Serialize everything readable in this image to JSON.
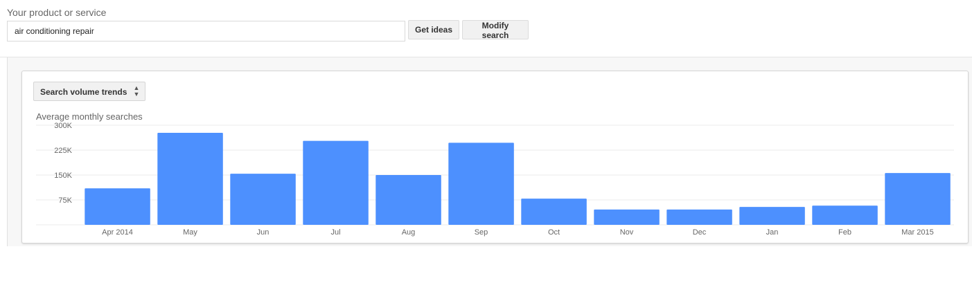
{
  "search": {
    "label": "Your product or service",
    "value": "air conditioning repair",
    "placeholder": ""
  },
  "buttons": {
    "get_ideas": "Get ideas",
    "modify_search": "Modify search"
  },
  "chart_panel": {
    "dropdown_label": "Search volume trends",
    "title": "Average monthly searches"
  },
  "colors": {
    "bar": "#4d90fe",
    "grid": "#ebebeb"
  },
  "chart_data": {
    "type": "bar",
    "title": "Average monthly searches",
    "xlabel": "",
    "ylabel": "",
    "categories": [
      "Apr 2014",
      "May",
      "Jun",
      "Jul",
      "Aug",
      "Sep",
      "Oct",
      "Nov",
      "Dec",
      "Jan",
      "Feb",
      "Mar 2015"
    ],
    "values": [
      110000,
      277000,
      154000,
      253000,
      150000,
      247000,
      79000,
      46000,
      46000,
      54000,
      58000,
      156000
    ],
    "yticks": [
      75000,
      150000,
      225000,
      300000
    ],
    "ytick_labels": [
      "75K",
      "150K",
      "225K",
      "300K"
    ],
    "ylim": [
      0,
      300000
    ],
    "grid": true,
    "legend": "none"
  }
}
